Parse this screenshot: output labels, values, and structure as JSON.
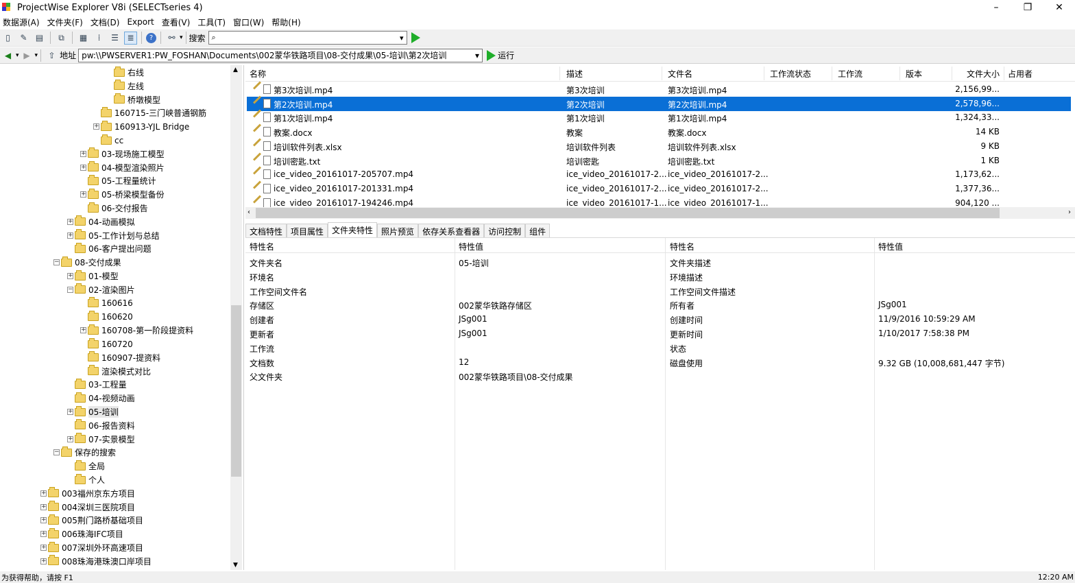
{
  "window": {
    "title": "ProjectWise Explorer V8i (SELECTseries 4)",
    "minimize": "–",
    "restore": "❐",
    "close": "✕"
  },
  "menu": [
    "数据源(A)",
    "文件夹(F)",
    "文档(D)",
    "Export",
    "查看(V)",
    "工具(T)",
    "窗口(W)",
    "帮助(H)"
  ],
  "search": {
    "label": "搜索",
    "value": "",
    "icon": "magnifier-icon"
  },
  "address": {
    "label": "地址",
    "value": "pw:\\\\PWSERVER1:PW_FOSHAN\\Documents\\002蒙华铁路项目\\08-交付成果\\05-培训\\第2次培训",
    "run": "运行"
  },
  "tree": [
    {
      "label": "右线",
      "indent": 4,
      "exp": ""
    },
    {
      "label": "左线",
      "indent": 4,
      "exp": ""
    },
    {
      "label": "桥墩模型",
      "indent": 4,
      "exp": ""
    },
    {
      "label": "160715-三门峡普通钢筋",
      "indent": 3,
      "exp": ""
    },
    {
      "label": "160913-YJL Bridge",
      "indent": 3,
      "exp": "+"
    },
    {
      "label": "cc",
      "indent": 3,
      "exp": ""
    },
    {
      "label": "03-现场施工模型",
      "indent": 2,
      "exp": "+"
    },
    {
      "label": "04-模型渲染照片",
      "indent": 2,
      "exp": "+"
    },
    {
      "label": "05-工程量统计",
      "indent": 2,
      "exp": ""
    },
    {
      "label": "05-桥梁模型备份",
      "indent": 2,
      "exp": "+"
    },
    {
      "label": "06-交付报告",
      "indent": 2,
      "exp": ""
    },
    {
      "label": "04-动画模拟",
      "indent": 1,
      "exp": "+"
    },
    {
      "label": "05-工作计划与总结",
      "indent": 1,
      "exp": "+"
    },
    {
      "label": "06-客户提出问题",
      "indent": 1,
      "exp": ""
    },
    {
      "label": "08-交付成果",
      "indent": 0,
      "exp": "−"
    },
    {
      "label": "01-模型",
      "indent": 1,
      "exp": "+"
    },
    {
      "label": "02-渲染图片",
      "indent": 1,
      "exp": "−"
    },
    {
      "label": "160616",
      "indent": 2,
      "exp": ""
    },
    {
      "label": "160620",
      "indent": 2,
      "exp": ""
    },
    {
      "label": "160708-第一阶段提资料",
      "indent": 2,
      "exp": "+"
    },
    {
      "label": "160720",
      "indent": 2,
      "exp": ""
    },
    {
      "label": "160907-提资料",
      "indent": 2,
      "exp": ""
    },
    {
      "label": "渲染模式对比",
      "indent": 2,
      "exp": ""
    },
    {
      "label": "03-工程量",
      "indent": 1,
      "exp": ""
    },
    {
      "label": "04-视频动画",
      "indent": 1,
      "exp": ""
    },
    {
      "label": "05-培训",
      "indent": 1,
      "exp": "+"
    },
    {
      "label": "06-报告资料",
      "indent": 1,
      "exp": ""
    },
    {
      "label": "07-实景模型",
      "indent": 1,
      "exp": "+"
    },
    {
      "label": "保存的搜索",
      "indent": 0,
      "exp": "−"
    },
    {
      "label": "全局",
      "indent": 1,
      "exp": ""
    },
    {
      "label": "个人",
      "indent": 1,
      "exp": ""
    },
    {
      "label": "003福州京东方项目",
      "indent": -1,
      "exp": "+"
    },
    {
      "label": "004深圳三医院项目",
      "indent": -1,
      "exp": "+"
    },
    {
      "label": "005荆门路桥基础项目",
      "indent": -1,
      "exp": "+"
    },
    {
      "label": "006珠海IFC项目",
      "indent": -1,
      "exp": "+"
    },
    {
      "label": "007深圳外环高速项目",
      "indent": -1,
      "exp": "+"
    },
    {
      "label": "008珠海港珠澳口岸项目",
      "indent": -1,
      "exp": "+"
    }
  ],
  "list": {
    "columns": [
      "名称",
      "描述",
      "文件名",
      "工作流状态",
      "工作流",
      "版本",
      "文件大小",
      "占用者"
    ],
    "rows": [
      {
        "name": "第3次培训.mp4",
        "desc": "第3次培训",
        "file": "第3次培训.mp4",
        "size": "2,156,99..."
      },
      {
        "name": "第2次培训.mp4",
        "desc": "第2次培训",
        "file": "第2次培训.mp4",
        "size": "2,578,96...",
        "selected": true
      },
      {
        "name": "第1次培训.mp4",
        "desc": "第1次培训",
        "file": "第1次培训.mp4",
        "size": "1,324,33..."
      },
      {
        "name": "教案.docx",
        "desc": "教案",
        "file": "教案.docx",
        "size": "14 KB"
      },
      {
        "name": "培训软件列表.xlsx",
        "desc": "培训软件列表",
        "file": "培训软件列表.xlsx",
        "size": "9 KB"
      },
      {
        "name": "培训密匙.txt",
        "desc": "培训密匙",
        "file": "培训密匙.txt",
        "size": "1 KB"
      },
      {
        "name": "ice_video_20161017-205707.mp4",
        "desc": "ice_video_20161017-2...",
        "file": "ice_video_20161017-2...",
        "size": "1,173,62..."
      },
      {
        "name": "ice_video_20161017-201331.mp4",
        "desc": "ice_video_20161017-2...",
        "file": "ice_video_20161017-2...",
        "size": "1,377,36..."
      },
      {
        "name": "ice_video_20161017-194246.mp4",
        "desc": "ice_video_20161017-1...",
        "file": "ice_video_20161017-1...",
        "size": "904,120 ..."
      }
    ]
  },
  "tabs": [
    "文档特性",
    "项目属性",
    "文件夹特性",
    "照片预览",
    "依存关系查看器",
    "访问控制",
    "组件"
  ],
  "props": {
    "headers": [
      "特性名",
      "特性值",
      "特性名",
      "特性值"
    ],
    "rows": [
      [
        "文件夹名",
        "05-培训",
        "文件夹描述",
        ""
      ],
      [
        "环境名",
        "",
        "环境描述",
        ""
      ],
      [
        "工作空间文件名",
        "",
        "工作空间文件描述",
        ""
      ],
      [
        "存储区",
        "002蒙华铁路存储区",
        "所有者",
        "JSg001"
      ],
      [
        "创建者",
        "JSg001",
        "创建时间",
        "11/9/2016 10:59:29 AM"
      ],
      [
        "更新者",
        "JSg001",
        "更新时间",
        "1/10/2017 7:58:38 PM"
      ],
      [
        "工作流",
        "",
        "状态",
        ""
      ],
      [
        "文档数",
        "12",
        "磁盘使用",
        "9.32 GB (10,008,681,447 字节)"
      ],
      [
        "父文件夹",
        "002蒙华铁路项目\\08-交付成果",
        "",
        ""
      ]
    ]
  },
  "status": {
    "left": "为获得帮助，请按 F1",
    "right": "12:20 AM"
  }
}
